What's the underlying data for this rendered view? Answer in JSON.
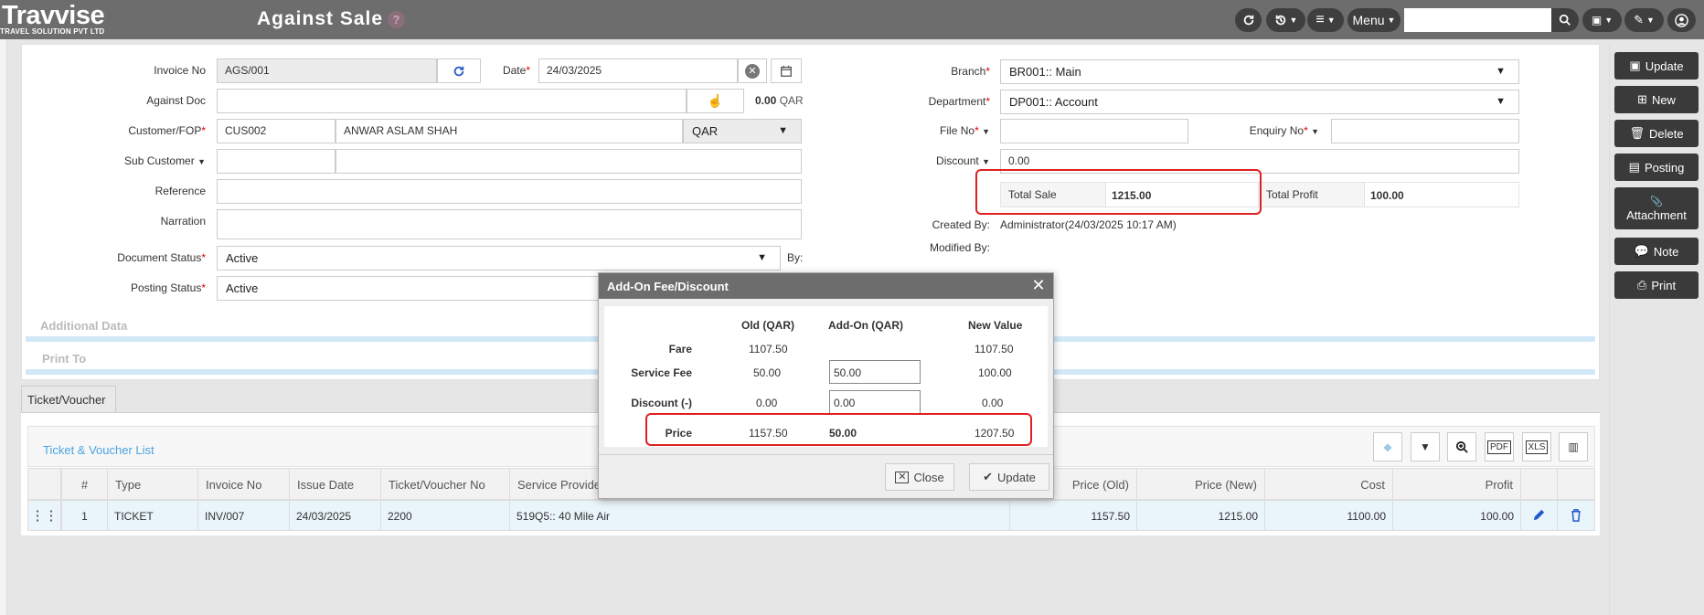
{
  "app": {
    "logo": "Travvise",
    "logo_sub": "TRAVEL SOLUTION PVT LTD",
    "page_title": "Against Sale",
    "help": "?",
    "menu_label": "Menu"
  },
  "form": {
    "invoice_no": {
      "label": "Invoice No",
      "value": "AGS/001"
    },
    "date": {
      "label": "Date",
      "value": "24/03/2025"
    },
    "against_doc": {
      "label": "Against Doc",
      "amount": "0.00",
      "currency": "QAR"
    },
    "customer": {
      "label": "Customer/FOP",
      "code": "CUS002",
      "name": "ANWAR ASLAM SHAH",
      "currency": "QAR"
    },
    "sub_customer": {
      "label": "Sub Customer"
    },
    "reference": {
      "label": "Reference"
    },
    "narration": {
      "label": "Narration"
    },
    "document_status": {
      "label": "Document Status",
      "value": "Active",
      "by_label": "By:"
    },
    "posting_status": {
      "label": "Posting Status",
      "value": "Active"
    },
    "branch": {
      "label": "Branch",
      "value": "BR001:: Main"
    },
    "department": {
      "label": "Department",
      "value": "DP001:: Account"
    },
    "file_no": {
      "label": "File No"
    },
    "enquiry_no": {
      "label": "Enquiry No"
    },
    "discount": {
      "label": "Discount",
      "value": "0.00"
    },
    "total_sale": {
      "label": "Total Sale",
      "value": "1215.00"
    },
    "total_profit": {
      "label": "Total Profit",
      "value": "100.00"
    },
    "created_by": {
      "label": "Created By:",
      "value": "Administrator(24/03/2025 10:17 AM)"
    },
    "modified_by": {
      "label": "Modified By:"
    }
  },
  "sections": {
    "additional_data": "Additional Data",
    "print_to": "Print To"
  },
  "side_buttons": [
    {
      "label": "Update",
      "icon": "save-icon"
    },
    {
      "label": "New",
      "icon": "plus-icon"
    },
    {
      "label": "Delete",
      "icon": "trash-icon"
    },
    {
      "label": "Posting",
      "icon": "book-icon"
    },
    {
      "label": "Attachment",
      "icon": "paperclip-icon"
    },
    {
      "label": "Note",
      "icon": "comment-icon"
    },
    {
      "label": "Print",
      "icon": "print-icon"
    }
  ],
  "grid": {
    "tab": "Ticket/Voucher",
    "title": "Ticket & Voucher List",
    "columns": [
      "#",
      "Type",
      "Invoice No",
      "Issue Date",
      "Ticket/Voucher No",
      "Service Provider",
      "Price (Old)",
      "Price (New)",
      "Cost",
      "Profit"
    ],
    "rows": [
      {
        "num": "1",
        "type": "TICKET",
        "invoice_no": "INV/007",
        "issue_date": "24/03/2025",
        "ticket_no": "2200",
        "provider": "519Q5:: 40 Mile Air",
        "price_old": "1157.50",
        "price_new": "1215.00",
        "cost": "1100.00",
        "profit": "100.00"
      }
    ]
  },
  "modal": {
    "title": "Add-On Fee/Discount",
    "headers": {
      "old": "Old (QAR)",
      "addon": "Add-On (QAR)",
      "new": "New Value"
    },
    "rows": {
      "fare": {
        "label": "Fare",
        "old": "1107.50",
        "new": "1107.50"
      },
      "service_fee": {
        "label": "Service Fee",
        "old": "50.00",
        "addon": "50.00",
        "new": "100.00"
      },
      "discount": {
        "label": "Discount (-)",
        "old": "0.00",
        "addon": "0.00",
        "new": "0.00"
      },
      "price": {
        "label": "Price",
        "old": "1157.50",
        "addon": "50.00",
        "new": "1207.50"
      }
    },
    "close_label": "Close",
    "update_label": "Update"
  },
  "colors": {
    "accent_blue": "#4aa3df",
    "highlight_red": "#e02020",
    "topbar": "#6d6d6d"
  }
}
